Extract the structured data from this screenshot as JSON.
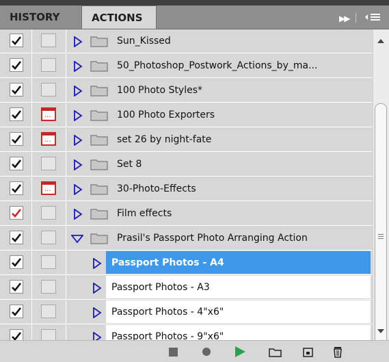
{
  "tabs": [
    {
      "label": "HISTORY"
    },
    {
      "label": "ACTIONS"
    }
  ],
  "panel_controls": {
    "fast_forward_icon": "double-triangle-right",
    "menu_icon": "panel-menu-lines"
  },
  "actions": [
    {
      "name": "Sun_Kissed",
      "checked": true,
      "dialog": false,
      "expanded": false
    },
    {
      "name": "50_Photoshop_Postwork_Actions_by_ma...",
      "checked": true,
      "dialog": false,
      "expanded": false
    },
    {
      "name": "100 Photo Styles*",
      "checked": true,
      "dialog": false,
      "expanded": false
    },
    {
      "name": "100 Photo Exporters",
      "checked": true,
      "dialog": true,
      "expanded": false
    },
    {
      "name": "set 26 by night-fate",
      "checked": true,
      "dialog": true,
      "expanded": false
    },
    {
      "name": "Set 8",
      "checked": true,
      "dialog": false,
      "expanded": false
    },
    {
      "name": "30-Photo-Effects",
      "checked": true,
      "dialog": true,
      "expanded": false
    },
    {
      "name": "Film effects",
      "checked": true,
      "check_color": "red",
      "dialog": false,
      "expanded": false
    },
    {
      "name": "Prasil's Passport Photo Arranging Action",
      "checked": true,
      "dialog": false,
      "expanded": true
    }
  ],
  "sub_actions": [
    {
      "name": "Passport Photos - A4",
      "checked": true,
      "selected": true
    },
    {
      "name": "Passport Photos - A3",
      "checked": true,
      "selected": false
    },
    {
      "name": "Passport Photos - 4\"x6\"",
      "checked": true,
      "selected": false
    },
    {
      "name": "Passport Photos - 9\"x6\"",
      "checked": true,
      "selected": false
    }
  ],
  "toolbar": {
    "buttons": [
      "stop-icon",
      "record-icon",
      "play-icon",
      "new-set-icon",
      "new-action-icon",
      "trash-icon"
    ]
  },
  "colors": {
    "selection": "#3f97ea",
    "check_red": "#c62828",
    "play_green": "#2aa24c",
    "triangle_blue": "#1b1bb5"
  }
}
